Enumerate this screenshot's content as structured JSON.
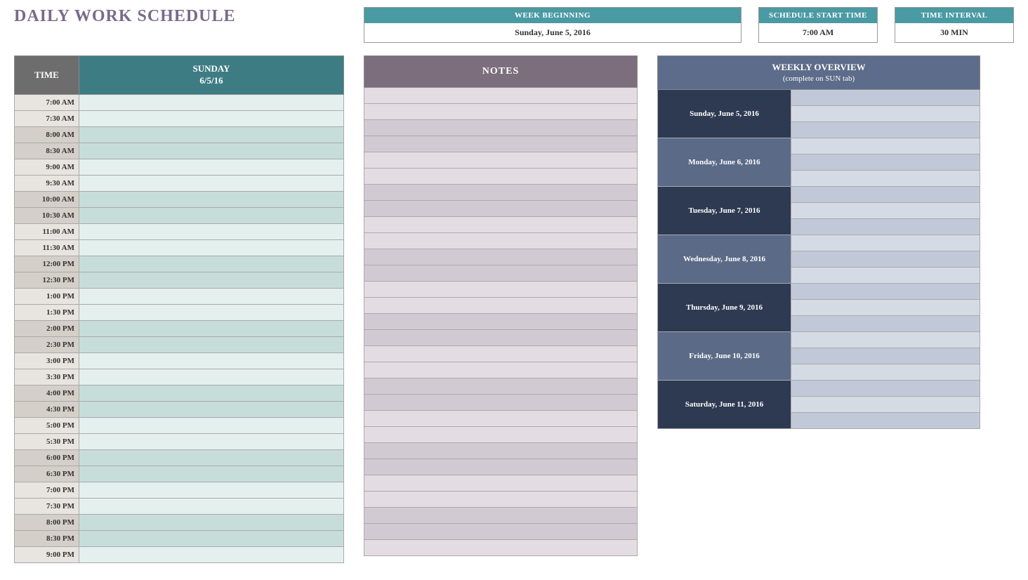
{
  "title": "DAILY WORK SCHEDULE",
  "info": {
    "week_beginning_label": "WEEK BEGINNING",
    "week_beginning_value": "Sunday, June 5, 2016",
    "start_time_label": "SCHEDULE START TIME",
    "start_time_value": "7:00 AM",
    "interval_label": "TIME INTERVAL",
    "interval_value": "30 MIN"
  },
  "schedule": {
    "time_header": "TIME",
    "day_header_line1": "SUNDAY",
    "day_header_line2": "6/5/16",
    "times": [
      "7:00 AM",
      "7:30 AM",
      "8:00 AM",
      "8:30 AM",
      "9:00 AM",
      "9:30 AM",
      "10:00 AM",
      "10:30 AM",
      "11:00 AM",
      "11:30 AM",
      "12:00 PM",
      "12:30 PM",
      "1:00 PM",
      "1:30 PM",
      "2:00 PM",
      "2:30 PM",
      "3:00 PM",
      "3:30 PM",
      "4:00 PM",
      "4:30 PM",
      "5:00 PM",
      "5:30 PM",
      "6:00 PM",
      "6:30 PM",
      "7:00 PM",
      "7:30 PM",
      "8:00 PM",
      "8:30 PM",
      "9:00 PM"
    ],
    "entries": [
      "",
      "",
      "",
      "",
      "",
      "",
      "",
      "",
      "",
      "",
      "",
      "",
      "",
      "",
      "",
      "",
      "",
      "",
      "",
      "",
      "",
      "",
      "",
      "",
      "",
      "",
      "",
      "",
      ""
    ]
  },
  "notes": {
    "header": "NOTES",
    "rows": [
      "",
      "",
      "",
      "",
      "",
      "",
      "",
      "",
      "",
      "",
      "",
      "",
      "",
      "",
      "",
      "",
      "",
      "",
      "",
      "",
      "",
      "",
      "",
      "",
      "",
      "",
      "",
      "",
      ""
    ]
  },
  "overview": {
    "header_line1": "WEEKLY OVERVIEW",
    "header_line2": "(complete on SUN tab)",
    "days": [
      {
        "label": "Sunday, June 5, 2016",
        "values": [
          "",
          "",
          ""
        ]
      },
      {
        "label": "Monday, June 6, 2016",
        "values": [
          "",
          "",
          ""
        ]
      },
      {
        "label": "Tuesday, June 7, 2016",
        "values": [
          "",
          "",
          ""
        ]
      },
      {
        "label": "Wednesday, June 8, 2016",
        "values": [
          "",
          "",
          ""
        ]
      },
      {
        "label": "Thursday, June 9, 2016",
        "values": [
          "",
          "",
          ""
        ]
      },
      {
        "label": "Friday, June 10, 2016",
        "values": [
          "",
          "",
          ""
        ]
      },
      {
        "label": "Saturday, June 11, 2016",
        "values": [
          "",
          "",
          ""
        ]
      }
    ]
  }
}
